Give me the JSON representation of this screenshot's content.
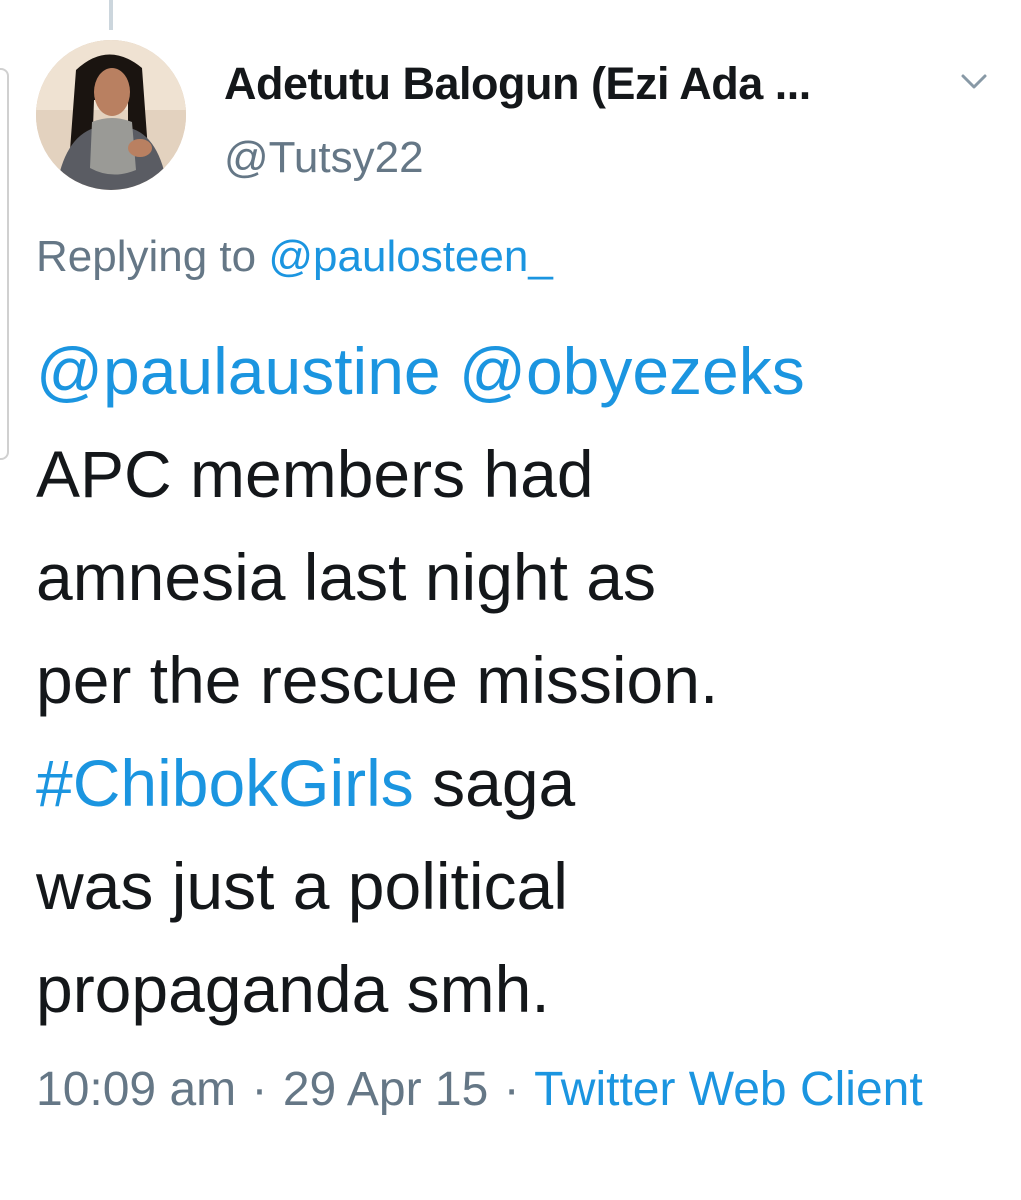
{
  "author": {
    "display_name": "Adetutu Balogun (Ezi Ada ...",
    "handle": "@Tutsy22"
  },
  "reply": {
    "prefix": "Replying to",
    "to_handle": "@paulosteen_"
  },
  "tweet": {
    "mentions": "@paulaustine @obyezeks",
    "line_2": "APC members had",
    "line_3": "amnesia last night as",
    "line_4": "per the rescue mission.",
    "hashtag": "#ChibokGirls",
    "line_5_rest": " saga",
    "line_6": "was just a political",
    "line_7": "propaganda smh."
  },
  "meta": {
    "time": "10:09 am",
    "separator": "·",
    "date": "29 Apr 15",
    "source": "Twitter Web Client"
  },
  "icons": {
    "more": "chevron-down-icon",
    "avatar": "profile-photo"
  },
  "colors": {
    "link": "#1b95e0",
    "text": "#14171a",
    "secondary": "#657786"
  }
}
